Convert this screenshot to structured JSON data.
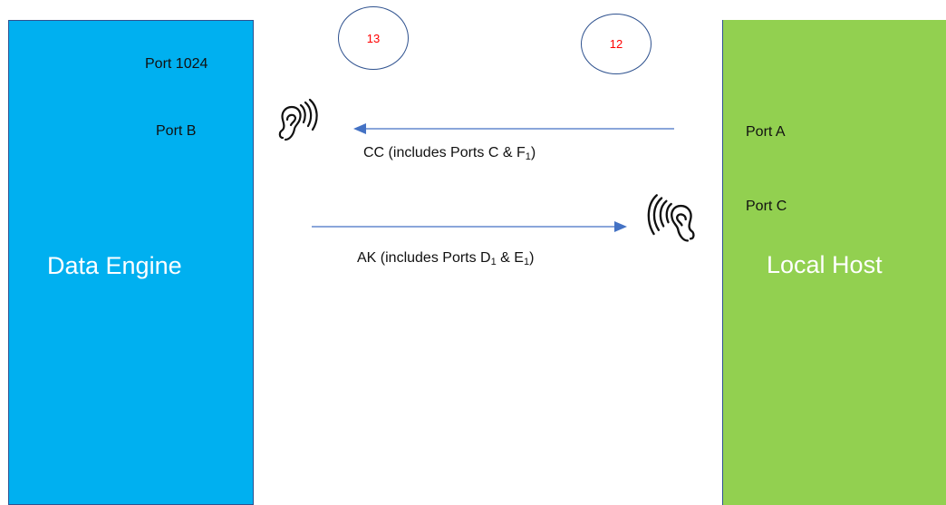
{
  "colors": {
    "data_engine_fill": "#00b0f0",
    "local_host_fill": "#92d050",
    "outline": "#2f528f",
    "arrow": "#4472c4",
    "circle_number": "#ff0000"
  },
  "data_engine": {
    "title": "Data Engine",
    "ports": [
      "Port 1024",
      "Port B"
    ]
  },
  "local_host": {
    "title": "Local Host",
    "ports": [
      "Port A",
      "Port C"
    ]
  },
  "circles": [
    "13",
    "12"
  ],
  "arrows": {
    "cc": {
      "prefix": "CC (includes Ports C & F",
      "sub": "1",
      "suffix": ")",
      "direction": "right-to-left"
    },
    "ak": {
      "prefix": "AK (includes Ports D",
      "sub1": "1",
      "mid": " & E",
      "sub2": "1",
      "suffix": ")",
      "direction": "left-to-right"
    }
  },
  "icons": [
    "listening-ear-icon",
    "listening-ear-icon"
  ]
}
